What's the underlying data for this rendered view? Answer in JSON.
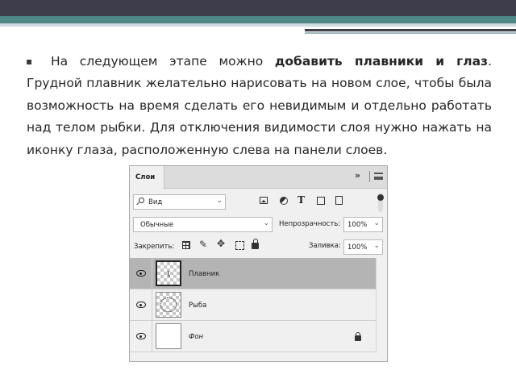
{
  "slide": {
    "bullet": "▪",
    "text_before": "На следующем этапе можно ",
    "text_bold": "добавить плавники и глаз",
    "text_after": ". Грудной плавник желательно нарисовать на новом слое, чтобы была возможность на время сделать его невидимым и отдельно работать над телом рыбки. Для отключения видимости слоя нужно нажать на иконку глаза, расположенную слева на панели слоев."
  },
  "panel": {
    "tab_label": "Слои",
    "more_glyph": "»",
    "kind_filter": {
      "value": "Вид",
      "chevron": "⌄"
    },
    "blend_mode": {
      "value": "Обычные",
      "chevron": "⌄"
    },
    "opacity": {
      "label": "Непрозрачность:",
      "value": "100%",
      "chevron": "⌄"
    },
    "lock_label": "Закрепить:",
    "fill": {
      "label": "Заливка:",
      "value": "100%",
      "chevron": "⌄"
    },
    "filter_type_glyph": "T",
    "brush_glyph": "✎",
    "move_glyph": "✥",
    "layers": [
      {
        "name": "Плавник",
        "visible": true,
        "selected": true
      },
      {
        "name": "Рыба",
        "visible": true,
        "selected": false
      },
      {
        "name": "Фон",
        "visible": true,
        "selected": false,
        "locked": true
      }
    ]
  },
  "colors": {
    "header_dark": "#3d3d4c",
    "header_accent": "#4f8688",
    "selected_layer": "#b4b4b4",
    "panel_bg": "#f0f0f0"
  }
}
